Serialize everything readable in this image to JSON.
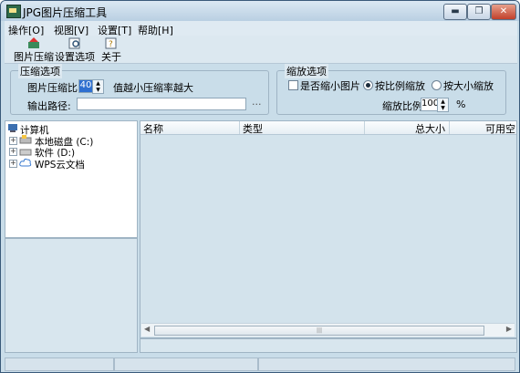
{
  "app": {
    "title": "JPG图片压缩工具"
  },
  "window_buttons": {
    "minimize": "▬",
    "maximize": "❐",
    "close": "✕"
  },
  "menu": [
    "操作[O]",
    "视图[V]",
    "设置[T]",
    "帮助[H]"
  ],
  "toolbar": {
    "compress": "图片压缩",
    "settings": "设置选项",
    "about": "关于"
  },
  "compress_options": {
    "legend": "压缩选项",
    "ratio_label": "图片压缩比",
    "ratio_value": "40",
    "hint": "值越小压缩率越大",
    "output_label": "输出路径:",
    "output_value": "",
    "browse": "..."
  },
  "scale_options": {
    "legend": "缩放选项",
    "scale_checkbox": "是否缩小图片",
    "by_ratio": "按比例缩放",
    "by_size": "按大小缩放",
    "ratio_label": "缩放比例",
    "ratio_value": "100",
    "percent": "%"
  },
  "tree": {
    "root": "计算机",
    "items": [
      "本地磁盘 (C:)",
      "软件 (D:)",
      "WPS云文档"
    ]
  },
  "file_list": {
    "columns": [
      "名称",
      "类型",
      "总大小",
      "可用空"
    ]
  }
}
